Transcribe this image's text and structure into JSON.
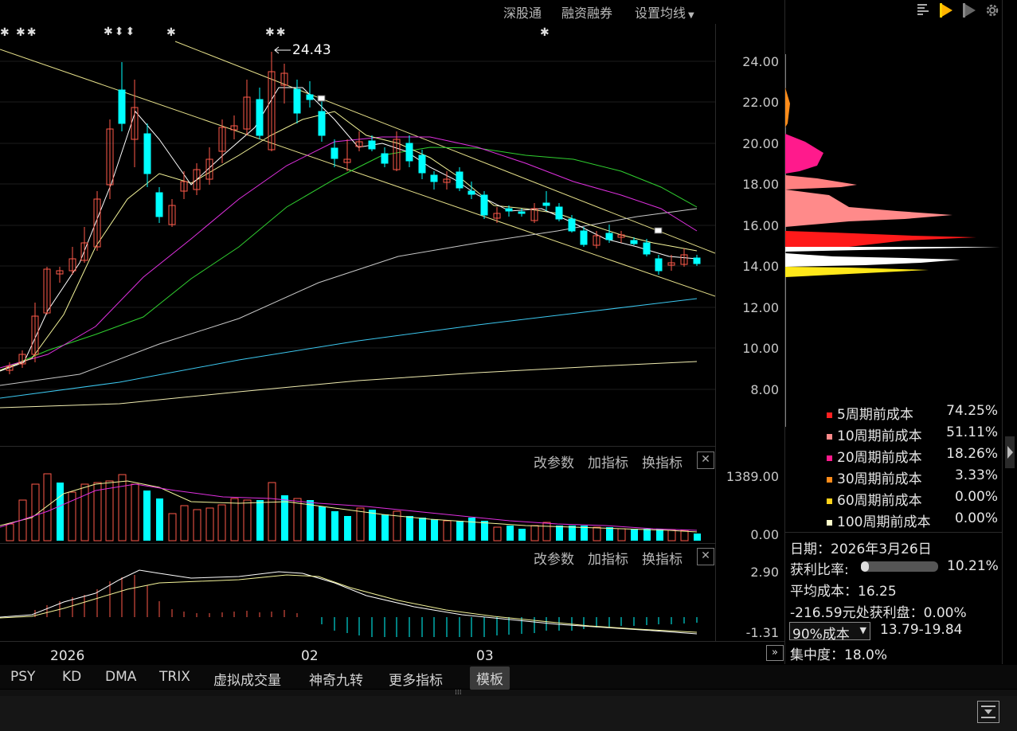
{
  "toolbar": {
    "shenzhen_connect": "深股通",
    "margin_trading": "融资融券",
    "ma_settings": "设置均线"
  },
  "main_chart": {
    "high_label": "24.43",
    "y_ticks": [
      "24.00",
      "22.00",
      "20.00",
      "18.00",
      "16.00",
      "14.00",
      "12.00",
      "10.00",
      "8.00"
    ]
  },
  "vol_panel": {
    "change_params": "改参数",
    "add_indicator": "加指标",
    "switch_indicator": "换指标",
    "y_ticks": [
      "1389.00",
      "0.00"
    ]
  },
  "macd_panel": {
    "change_params": "改参数",
    "add_indicator": "加指标",
    "switch_indicator": "换指标",
    "y_ticks": [
      "2.90",
      "-1.31"
    ]
  },
  "x_axis": {
    "labels": [
      "2026",
      "02",
      "03"
    ]
  },
  "bottom_tabs": [
    "PSY",
    "KD",
    "DMA",
    "TRIX",
    "虚拟成交量",
    "神奇九转",
    "更多指标",
    "模板"
  ],
  "chip_legend": [
    {
      "label": "5周期前成本",
      "value": "74.25%",
      "color": "#ff2020"
    },
    {
      "label": "10周期前成本",
      "value": "51.11%",
      "color": "#ff8a8a"
    },
    {
      "label": "20周期前成本",
      "value": "18.26%",
      "color": "#ff1a8c"
    },
    {
      "label": "30周期前成本",
      "value": "3.33%",
      "color": "#ff8c1a"
    },
    {
      "label": "60周期前成本",
      "value": "0.00%",
      "color": "#ffd21a"
    },
    {
      "label": "100周期前成本",
      "value": "0.00%",
      "color": "#ffffcc"
    }
  ],
  "chip_info": {
    "date": "日期：2026年3月26日",
    "profit_ratio_label": "获利比率:",
    "profit_ratio_value": "10.21%",
    "profit_ratio_fraction": 0.1021,
    "avg_cost": "平均成本：16.25",
    "profit_at": "-216.59元处获利盘：0.00%",
    "cost_select": "90%成本",
    "cost_range": "13.79-19.84",
    "concentration": "集中度：18.0%"
  },
  "colors": {
    "up": "#ff5a4a",
    "down": "#00ffff",
    "background": "#000000"
  }
}
